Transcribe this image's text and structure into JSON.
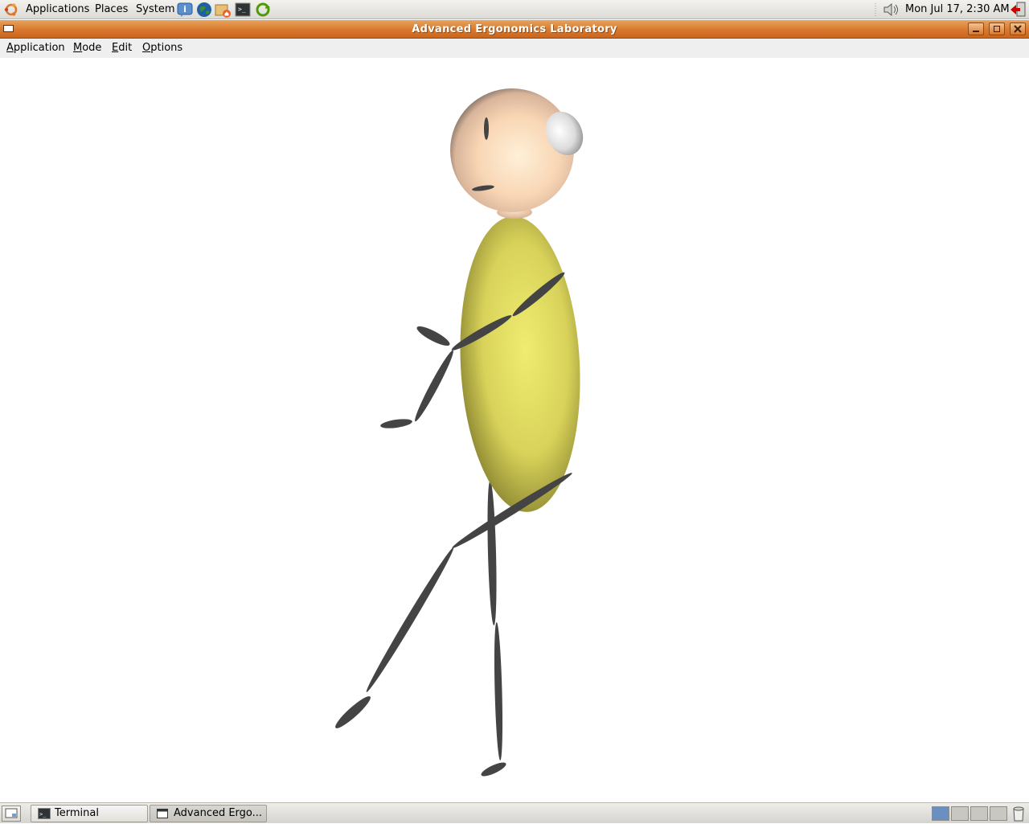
{
  "top_panel": {
    "menus": [
      "Applications",
      "Places",
      "System"
    ],
    "launchers": [
      "help-icon",
      "web-browser-icon",
      "home-folder-icon",
      "terminal-icon",
      "update-icon"
    ],
    "clock": "Mon Jul 17,  2:30 AM"
  },
  "window": {
    "title": "Advanced Ergonomics Laboratory"
  },
  "menubar": {
    "application": {
      "u": "A",
      "rest": "pplication"
    },
    "mode": {
      "u": "M",
      "rest": "ode"
    },
    "edit": {
      "u": "E",
      "rest": "dit"
    },
    "options": {
      "u": "O",
      "rest": "ptions"
    }
  },
  "taskbar": {
    "tasks": [
      "Terminal",
      "Advanced Ergo..."
    ],
    "workspaces": 4,
    "active_workspace": 1
  },
  "colors": {
    "titlebar": "#d9782e",
    "torso": "#e8e466",
    "head": "#f8d6b4",
    "limbs": "#444444"
  }
}
